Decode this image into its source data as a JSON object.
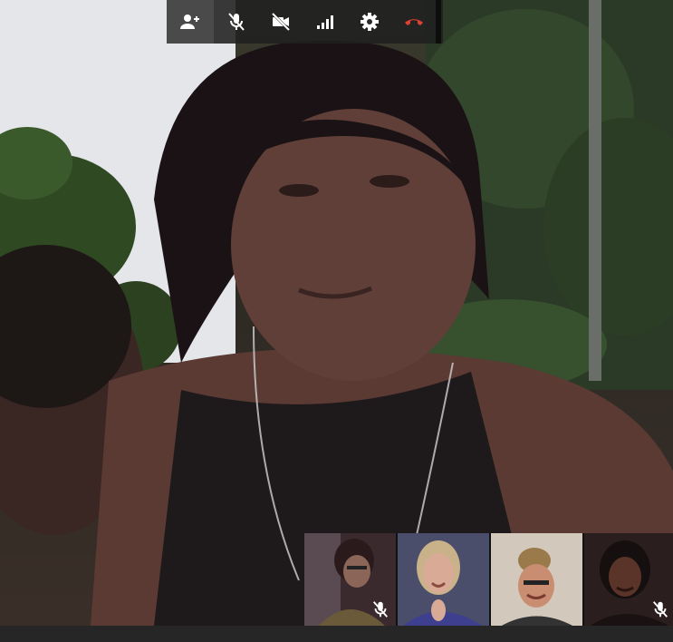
{
  "toolbar": {
    "buttons": [
      {
        "name": "invite-people",
        "icon": "person-add-icon",
        "active": true
      },
      {
        "name": "microphone",
        "icon": "mic-off-icon",
        "state": "muted"
      },
      {
        "name": "camera",
        "icon": "videocam-off-icon",
        "state": "off"
      },
      {
        "name": "bandwidth",
        "icon": "signal-bars-icon"
      },
      {
        "name": "settings",
        "icon": "gear-icon"
      },
      {
        "name": "hang-up",
        "icon": "phone-hangup-icon",
        "color": "#e0402f"
      }
    ]
  },
  "participants": [
    {
      "position": 1,
      "muted": true
    },
    {
      "position": 2,
      "muted": false
    },
    {
      "position": 3,
      "muted": false
    },
    {
      "position": 4,
      "muted": true
    }
  ],
  "colors": {
    "toolbar_bg": "#202020",
    "hangup_red": "#e0402f",
    "icon_white": "#ffffff"
  }
}
